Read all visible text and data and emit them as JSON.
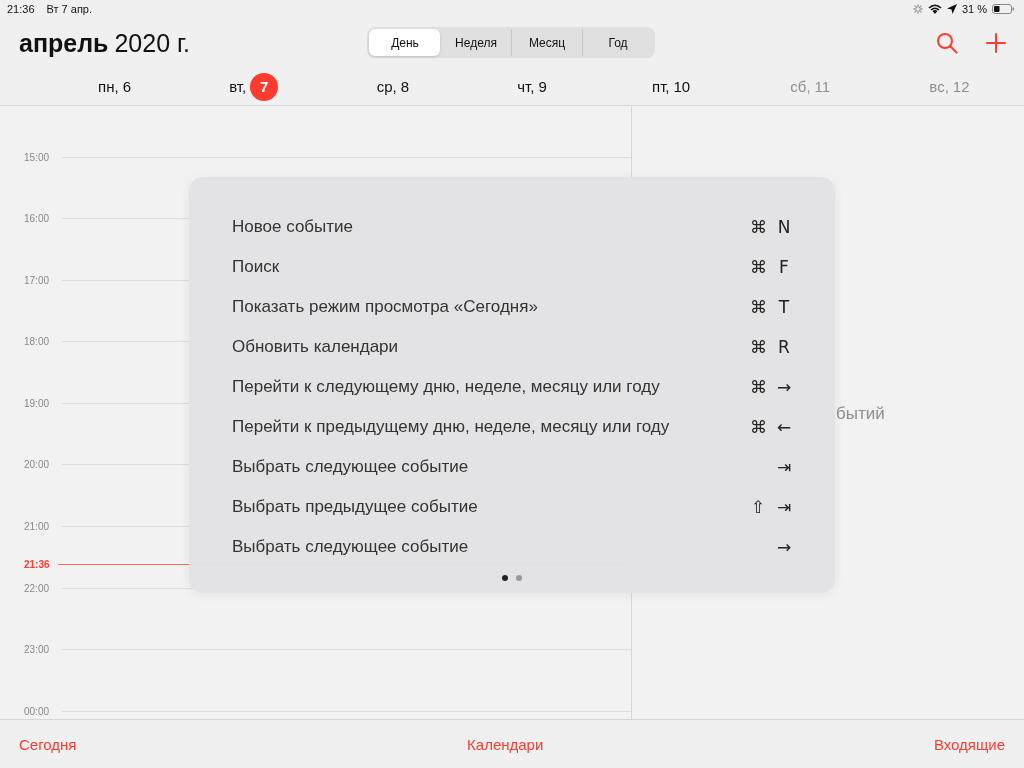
{
  "status_bar": {
    "time": "21:36",
    "date": "Вт 7 апр.",
    "battery": "31 %"
  },
  "header": {
    "month": "апрель",
    "year": "2020 г.",
    "view_tabs": [
      {
        "label": "День",
        "selected": true
      },
      {
        "label": "Неделя",
        "selected": false
      },
      {
        "label": "Месяц",
        "selected": false
      },
      {
        "label": "Год",
        "selected": false
      }
    ]
  },
  "week": [
    {
      "weekday": "пн,",
      "day": "6",
      "selected": false,
      "weekend": false
    },
    {
      "weekday": "вт,",
      "day": "7",
      "selected": true,
      "weekend": false
    },
    {
      "weekday": "ср,",
      "day": "8",
      "selected": false,
      "weekend": false
    },
    {
      "weekday": "чт,",
      "day": "9",
      "selected": false,
      "weekend": false
    },
    {
      "weekday": "пт,",
      "day": "10",
      "selected": false,
      "weekend": false
    },
    {
      "weekday": "сб,",
      "day": "11",
      "selected": false,
      "weekend": true
    },
    {
      "weekday": "вс,",
      "day": "12",
      "selected": false,
      "weekend": true
    }
  ],
  "hours": [
    "15:00",
    "16:00",
    "17:00",
    "18:00",
    "19:00",
    "20:00",
    "21:00",
    "22:00",
    "23:00",
    "00:00"
  ],
  "current_time": "21:36",
  "empty_note": "бытий",
  "shortcuts": [
    {
      "label": "Новое событие",
      "keys": [
        "⌘",
        "N"
      ]
    },
    {
      "label": "Поиск",
      "keys": [
        "⌘",
        "F"
      ]
    },
    {
      "label": "Показать режим просмотра «Сегодня»",
      "keys": [
        "⌘",
        "T"
      ]
    },
    {
      "label": "Обновить календари",
      "keys": [
        "⌘",
        "R"
      ]
    },
    {
      "label": "Перейти к следующему дню, неделе, месяцу или году",
      "keys": [
        "⌘",
        "→"
      ]
    },
    {
      "label": "Перейти к предыдущему дню, неделе, месяцу или году",
      "keys": [
        "⌘",
        "←"
      ]
    },
    {
      "label": "Выбрать следующее событие",
      "keys": [
        "⇥"
      ]
    },
    {
      "label": "Выбрать предыдущее событие",
      "keys": [
        "⇧",
        "⇥"
      ]
    },
    {
      "label": "Выбрать следующее событие",
      "keys": [
        "→"
      ]
    }
  ],
  "pages": [
    {
      "selected": true
    },
    {
      "selected": false
    }
  ],
  "toolbar": [
    "Сегодня",
    "Календари",
    "Входящие"
  ]
}
